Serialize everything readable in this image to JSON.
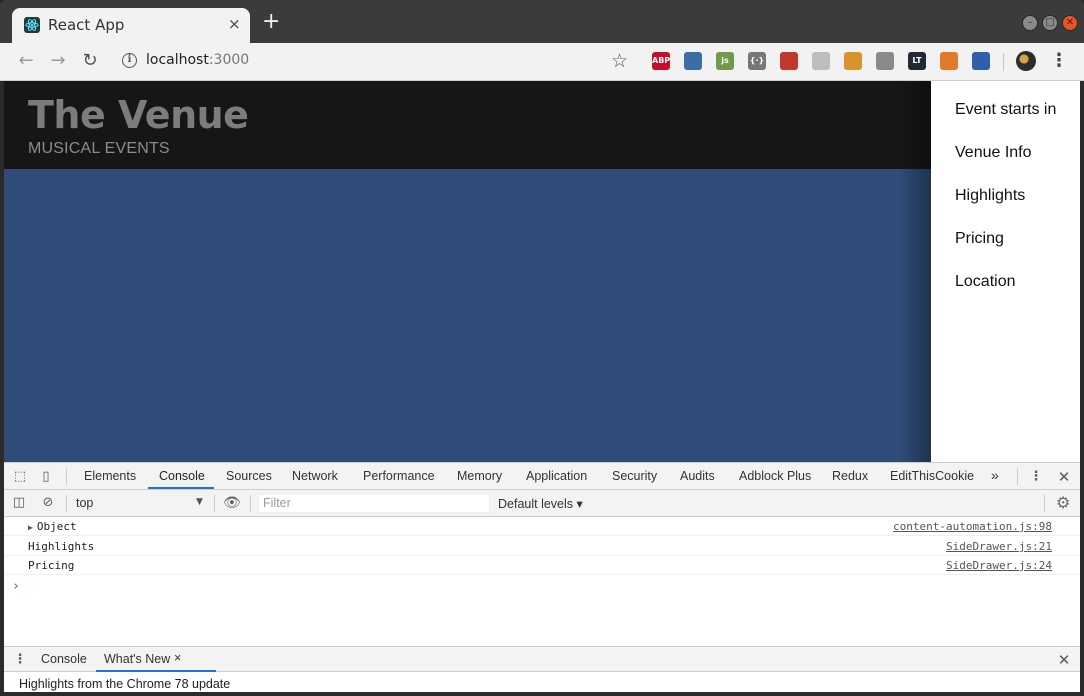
{
  "browser": {
    "tab_title": "React App",
    "tab_close": "×",
    "new_tab": "+",
    "url_host": "localhost",
    "url_port": ":3000",
    "extensions": [
      {
        "name": "adblock-plus-icon",
        "label": "ABP",
        "color": "#c70d2c"
      },
      {
        "name": "color-picker-icon",
        "label": "",
        "color": "#3a6ea5"
      },
      {
        "name": "js-toggle-icon",
        "label": "js",
        "color": "#6f9a4a"
      },
      {
        "name": "json-viewer-icon",
        "label": "{·}",
        "color": "#777777"
      },
      {
        "name": "page-ruler-icon",
        "label": "",
        "color": "#c0392b"
      },
      {
        "name": "timer-icon",
        "label": "",
        "color": "#bdbdbd"
      },
      {
        "name": "cookie-icon",
        "label": "",
        "color": "#d9922e"
      },
      {
        "name": "wappalyzer-icon",
        "label": "",
        "color": "#8a8a8a"
      },
      {
        "name": "lt-icon",
        "label": "LT",
        "color": "#1f2a36"
      },
      {
        "name": "tampermonkey-icon",
        "label": "",
        "color": "#e07b2c"
      },
      {
        "name": "save-icon",
        "label": "",
        "color": "#2f5fa8"
      }
    ]
  },
  "site": {
    "title": "The Venue",
    "subtitle": "MUSICAL EVENTS"
  },
  "side_drawer": {
    "items": [
      {
        "label": "Event starts in"
      },
      {
        "label": "Venue Info"
      },
      {
        "label": "Highlights"
      },
      {
        "label": "Pricing"
      },
      {
        "label": "Location"
      }
    ]
  },
  "devtools": {
    "tabs": [
      {
        "label": "Elements"
      },
      {
        "label": "Console"
      },
      {
        "label": "Sources"
      },
      {
        "label": "Network"
      },
      {
        "label": "Performance"
      },
      {
        "label": "Memory"
      },
      {
        "label": "Application"
      },
      {
        "label": "Security"
      },
      {
        "label": "Audits"
      },
      {
        "label": "Adblock Plus"
      },
      {
        "label": "Redux"
      },
      {
        "label": "EditThisCookie"
      }
    ],
    "more_tabs": "»",
    "active_tab": "Console",
    "context": "top",
    "filter_placeholder": "Filter",
    "levels": "Default levels ▾",
    "logs": [
      {
        "message": "Object",
        "source": "content-automation.js:98",
        "expandable": true
      },
      {
        "message": "Highlights",
        "source": "SideDrawer.js:21",
        "expandable": false
      },
      {
        "message": "Pricing",
        "source": "SideDrawer.js:24",
        "expandable": false
      }
    ],
    "prompt": "›",
    "drawer_tabs": [
      {
        "label": "Console"
      },
      {
        "label": "What's New"
      }
    ],
    "drawer_close": "×",
    "whats_new_text": "Highlights from the Chrome 78 update"
  }
}
